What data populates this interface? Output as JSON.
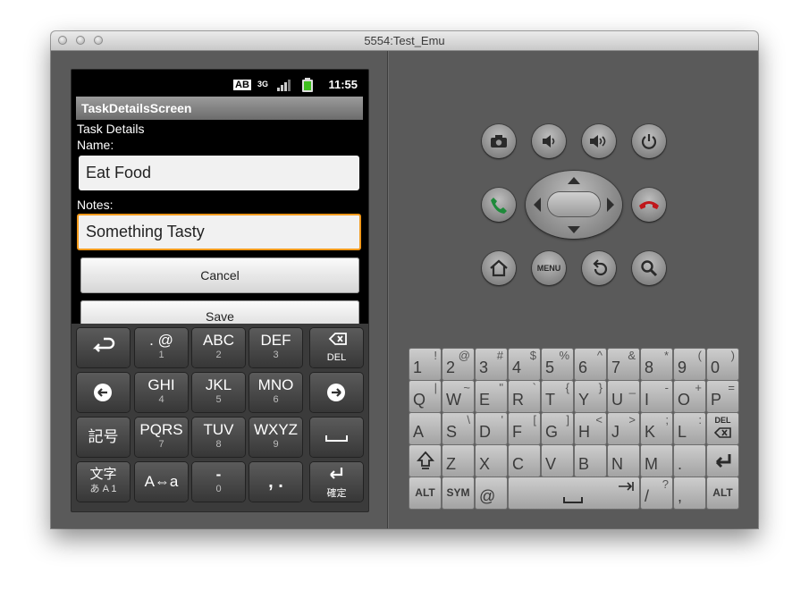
{
  "window": {
    "title": "5554:Test_Emu"
  },
  "statusbar": {
    "ime": "AB",
    "network": "3G",
    "clock": "11:55"
  },
  "app": {
    "title": "TaskDetailsScreen",
    "header": "Task Details",
    "name_label": "Name:",
    "name_value": "Eat Food",
    "notes_label": "Notes:",
    "notes_value": "Something Tasty",
    "cancel_label": "Cancel",
    "save_label": "Save"
  },
  "ime_keyboard": {
    "keys": {
      "k12": {
        "main": ". @",
        "sub": "1"
      },
      "k13": {
        "main": "ABC",
        "sub": "2"
      },
      "k14": {
        "main": "DEF",
        "sub": "3"
      },
      "k15": {
        "main": "",
        "sub": "DEL"
      },
      "k22": {
        "main": "GHI",
        "sub": "4"
      },
      "k23": {
        "main": "JKL",
        "sub": "5"
      },
      "k24": {
        "main": "MNO",
        "sub": "6"
      },
      "k31": {
        "main": "記号",
        "sub": ""
      },
      "k32": {
        "main": "PQRS",
        "sub": "7"
      },
      "k33": {
        "main": "TUV",
        "sub": "8"
      },
      "k34": {
        "main": "WXYZ",
        "sub": "9"
      },
      "k41": {
        "main": "文字",
        "sub": "あ A 1"
      },
      "k42": {
        "main": "A⇔a",
        "sub": ""
      },
      "k43": {
        "main": "-",
        "sub": "0"
      },
      "k44": {
        "main": ",  .",
        "sub": ""
      },
      "k45": {
        "main": "",
        "sub": "確定"
      }
    }
  },
  "controls": {
    "menu_label": "MENU"
  },
  "qwerty": {
    "row1": [
      [
        "1",
        "!"
      ],
      [
        "2",
        "@"
      ],
      [
        "3",
        "#"
      ],
      [
        "4",
        "$"
      ],
      [
        "5",
        "%"
      ],
      [
        "6",
        "^"
      ],
      [
        "7",
        "&"
      ],
      [
        "8",
        "*"
      ],
      [
        "9",
        "("
      ],
      [
        "0",
        ")"
      ]
    ],
    "row2": [
      [
        "Q",
        "|"
      ],
      [
        "W",
        "~"
      ],
      [
        "E",
        "\""
      ],
      [
        "R",
        "`"
      ],
      [
        "T",
        "{"
      ],
      [
        "Y",
        "}"
      ],
      [
        "U",
        "_"
      ],
      [
        "I",
        "-"
      ],
      [
        "O",
        "+"
      ],
      [
        "P",
        "="
      ]
    ],
    "row3": [
      [
        "A",
        ""
      ],
      [
        "S",
        "\\"
      ],
      [
        "D",
        "'"
      ],
      [
        "F",
        "["
      ],
      [
        "G",
        "]"
      ],
      [
        "H",
        "<"
      ],
      [
        "J",
        ">"
      ],
      [
        "K",
        ";"
      ],
      [
        "L",
        ":"
      ]
    ],
    "row4": [
      [
        "Z",
        ""
      ],
      [
        "X",
        ""
      ],
      [
        "C",
        ""
      ],
      [
        "V",
        ""
      ],
      [
        "B",
        ""
      ],
      [
        "N",
        ""
      ],
      [
        "M",
        ""
      ],
      [
        ".",
        ""
      ]
    ],
    "del_label": "DEL",
    "alt_label": "ALT",
    "sym_label": "SYM",
    "at_label": "@",
    "slash_label": "/",
    "slash_sub": "?",
    "comma_label": ","
  }
}
